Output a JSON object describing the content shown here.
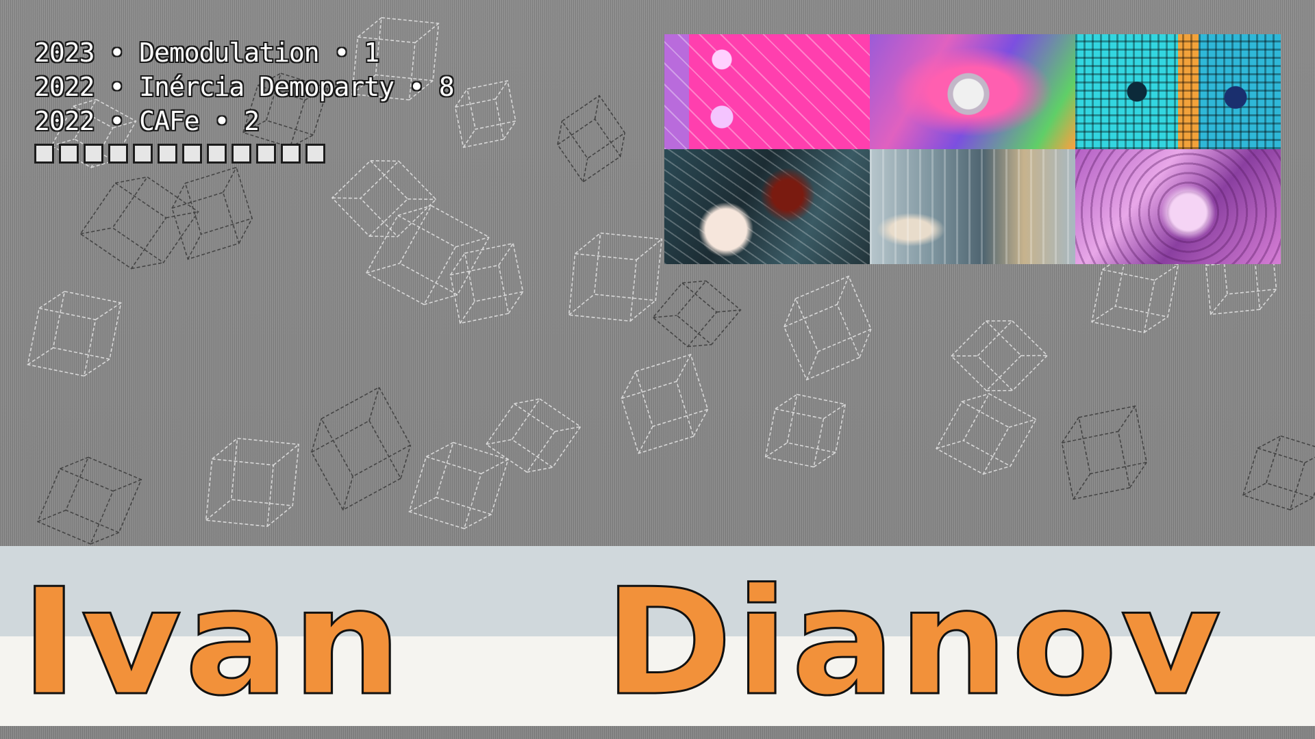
{
  "results": [
    {
      "text": "2023 • Demodulation • 1"
    },
    {
      "text": "2022 • Inércia Demoparty • 8"
    },
    {
      "text": "2022 • CAFe • 2"
    }
  ],
  "progress_boxes": 12,
  "gallery": [
    {
      "icon": "pink-fractal-thumbnail"
    },
    {
      "icon": "swirl-fractal-thumbnail"
    },
    {
      "icon": "cyan-lattice-thumbnail"
    },
    {
      "icon": "teal-coral-thumbnail"
    },
    {
      "icon": "grey-structure-thumbnail"
    },
    {
      "icon": "purple-flower-thumbnail"
    }
  ],
  "name": {
    "first": "Ivan",
    "last": "Dianov"
  },
  "colors": {
    "background": "#8a8a8a",
    "accent_orange": "#f2913a",
    "band_top": "#d0d8dc",
    "band_bottom": "#f5f4f0",
    "text_white": "#ffffff"
  }
}
